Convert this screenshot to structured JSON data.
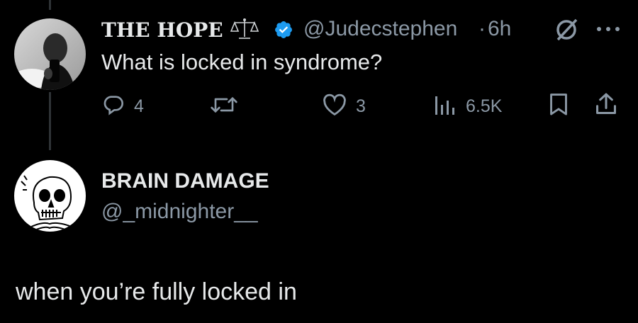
{
  "parent_tweet": {
    "display_name": "THE HOPE",
    "name_emoji": "⚖️",
    "handle": "@Judecstephen",
    "separator": "·",
    "time": "6h",
    "text": "What is locked in syndrome?",
    "verified": true,
    "actions": {
      "replies": "4",
      "retweets": "",
      "likes": "3",
      "views": "6.5K"
    }
  },
  "reply_tweet": {
    "display_name": "BRAIN DAMAGE",
    "handle": "@_midnighter__",
    "text": "when you’re fully locked in"
  },
  "colors": {
    "background": "#000000",
    "primary_text": "#e7e9ea",
    "secondary_text": "#8b98a5",
    "verified_blue": "#1d9bf0",
    "thread_line": "#2f3336"
  }
}
